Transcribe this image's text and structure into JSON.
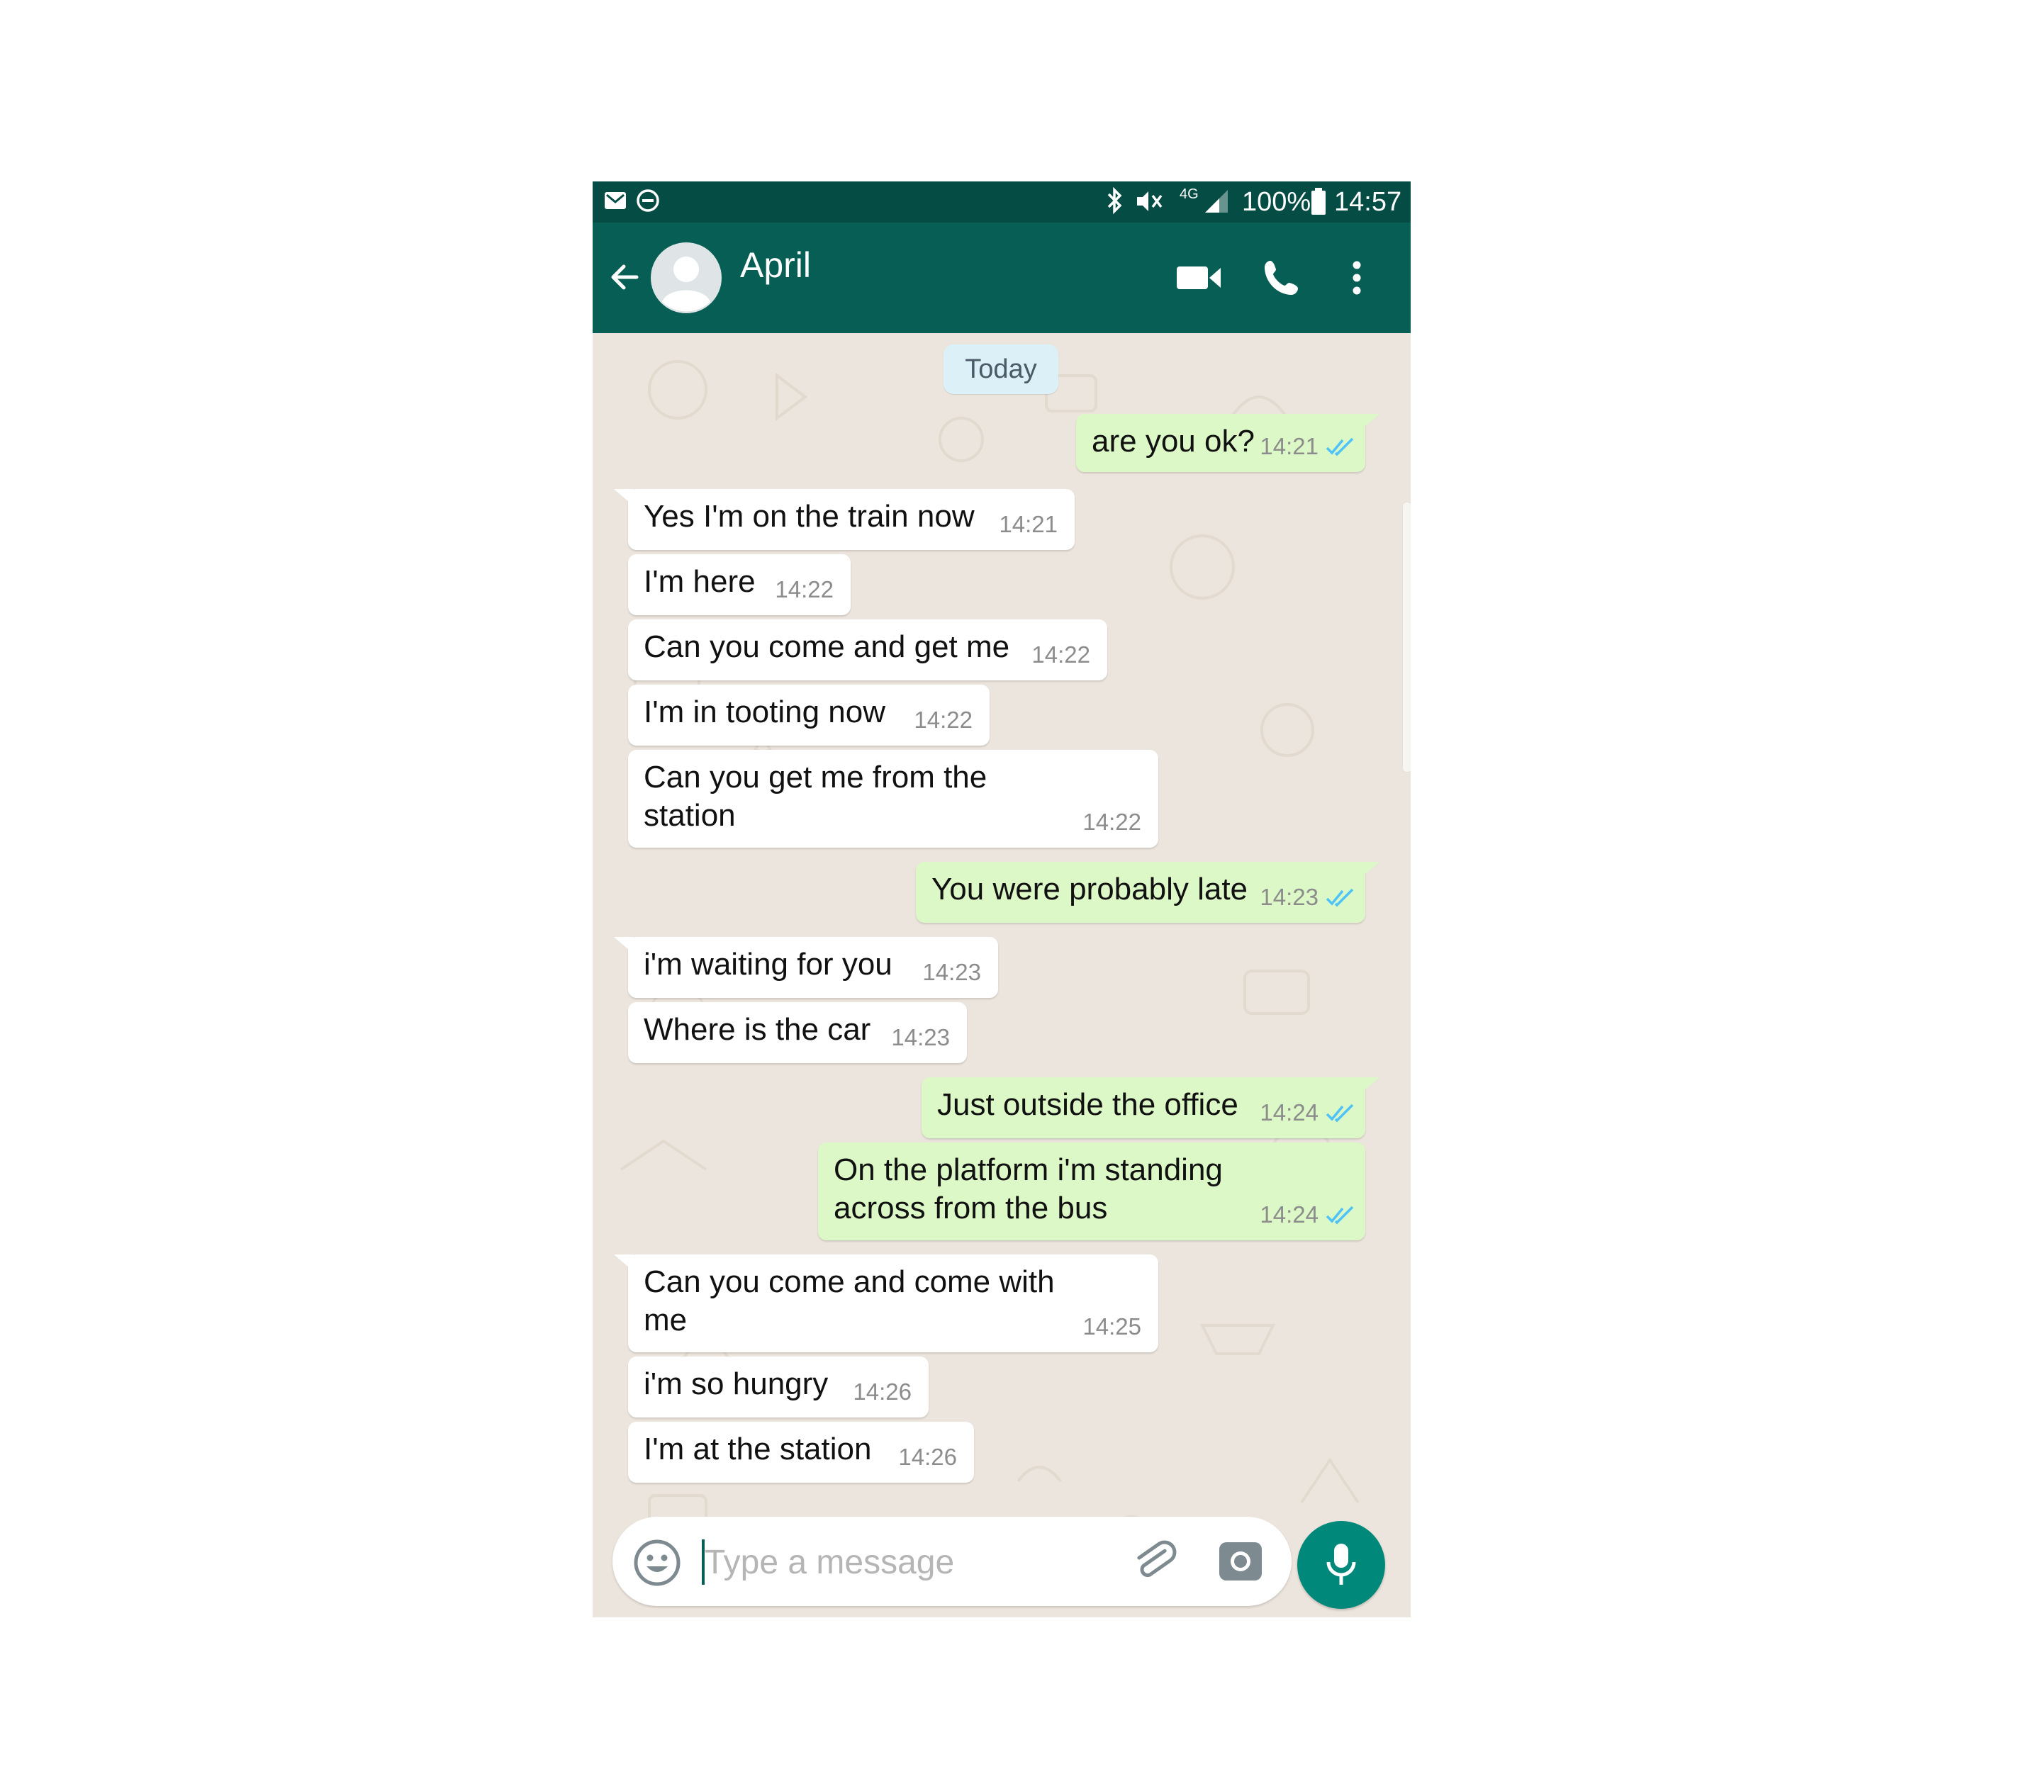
{
  "status_bar": {
    "battery": "100%",
    "time": "14:57",
    "network": "4G",
    "icons": [
      "mail-icon",
      "do-not-disturb-icon",
      "bluetooth-icon",
      "vibrate-icon",
      "network-4g-icon",
      "signal-icon",
      "battery-icon"
    ]
  },
  "header": {
    "contact_name": "April",
    "icons": [
      "back-arrow-icon",
      "avatar",
      "video-call-icon",
      "phone-icon",
      "more-vert-icon"
    ]
  },
  "chat": {
    "date_label": "Today",
    "messages": [
      {
        "dir": "out",
        "text": "are you ok?",
        "time": "14:21",
        "status": "read"
      },
      {
        "dir": "in",
        "text": "Yes I'm on the train now",
        "time": "14:21"
      },
      {
        "dir": "in",
        "text": "I'm here",
        "time": "14:22"
      },
      {
        "dir": "in",
        "text": "Can you come and get me",
        "time": "14:22"
      },
      {
        "dir": "in",
        "text": "I'm in tooting now",
        "time": "14:22"
      },
      {
        "dir": "in",
        "text": "Can you get me from the\nstation",
        "time": "14:22"
      },
      {
        "dir": "out",
        "text": "You were probably late",
        "time": "14:23",
        "status": "read"
      },
      {
        "dir": "in",
        "text": "i'm waiting for you",
        "time": "14:23"
      },
      {
        "dir": "in",
        "text": "Where is the car",
        "time": "14:23"
      },
      {
        "dir": "out",
        "text": "Just outside the office",
        "time": "14:24",
        "status": "read"
      },
      {
        "dir": "out",
        "text": "On the platform i'm standing\nacross from the bus",
        "time": "14:24",
        "status": "read"
      },
      {
        "dir": "in",
        "text": "Can you come and come with\nme",
        "time": "14:25"
      },
      {
        "dir": "in",
        "text": "i'm so hungry",
        "time": "14:26"
      },
      {
        "dir": "in",
        "text": "I'm at the station",
        "time": "14:26"
      }
    ]
  },
  "input": {
    "placeholder": "Type a message",
    "icons": [
      "emoji-icon",
      "attach-icon",
      "camera-icon",
      "mic-icon"
    ]
  },
  "colors": {
    "header": "#075e54",
    "status_bar": "#054c44",
    "outgoing_bubble": "#dcf8c6",
    "incoming_bubble": "#ffffff",
    "read_tick": "#4fc3f7",
    "mic_button": "#00897b",
    "chat_background": "#ece5dd"
  }
}
